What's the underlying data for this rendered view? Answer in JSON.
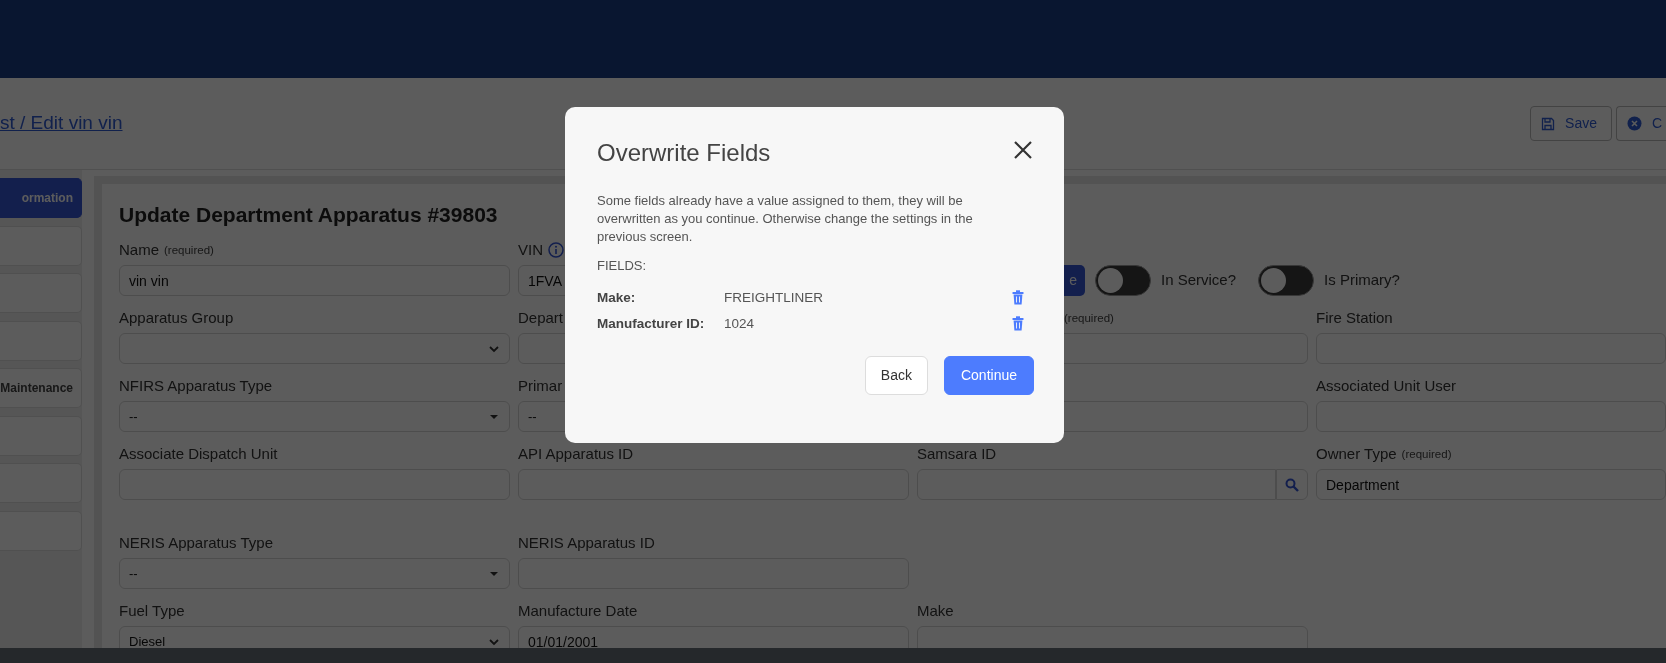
{
  "breadcrumb": {
    "text": "st / Edit vin vin"
  },
  "header_buttons": [
    {
      "kind": "save",
      "label": "Save"
    },
    {
      "kind": "cancel",
      "label": "C"
    }
  ],
  "sidebar": {
    "items": [
      {
        "label": "ormation",
        "selected": true
      },
      {
        "selected": false
      },
      {
        "selected": false
      },
      {
        "selected": false
      },
      {
        "label": "Maintenance",
        "selected": false
      },
      {
        "selected": false
      },
      {
        "selected": false
      },
      {
        "selected": false
      }
    ]
  },
  "form": {
    "title": "Update Department Apparatus #39803",
    "rows": [
      [
        {
          "kind": "input",
          "label": "Name",
          "note": "(required)",
          "value": "vin vin"
        },
        {
          "kind": "input",
          "label": "VIN",
          "info": true,
          "value": "1FVA"
        },
        {
          "kind": "toggles",
          "button": "e",
          "toggles": [
            {
              "label": "In Service?",
              "on": false
            },
            {
              "label": "Is Primary?",
              "on": false
            }
          ]
        }
      ],
      [
        {
          "kind": "select",
          "label": "Apparatus Group"
        },
        {
          "kind": "input",
          "label": "Depart"
        },
        {
          "kind": "input",
          "note": "(required)"
        },
        {
          "kind": "input",
          "label": "Fire Station"
        }
      ],
      [
        {
          "kind": "dropdown",
          "label": "NFIRS Apparatus Type",
          "value": "--"
        },
        {
          "kind": "dropdown",
          "label": "Primar",
          "value": "--"
        },
        {
          "kind": "input"
        },
        {
          "kind": "input",
          "label": "Associated Unit User"
        }
      ],
      [
        {
          "kind": "input",
          "label": "Associate Dispatch Unit"
        },
        {
          "kind": "input",
          "label": "API Apparatus ID"
        },
        {
          "kind": "search",
          "label": "Samsara ID"
        },
        {
          "kind": "input",
          "label": "Owner Type",
          "note": "(required)",
          "value": "Department"
        }
      ],
      [
        {
          "kind": "dropdown",
          "label": "NERIS Apparatus Type",
          "value": "--"
        },
        {
          "kind": "input",
          "label": "NERIS Apparatus ID"
        }
      ],
      [
        {
          "kind": "select",
          "label": "Fuel Type",
          "value": "Diesel"
        },
        {
          "kind": "input",
          "label": "Manufacture Date",
          "value": "01/01/2001"
        },
        {
          "kind": "input",
          "label": "Make"
        }
      ]
    ]
  },
  "modal": {
    "title": "Overwrite Fields",
    "message": "Some fields already have a value assigned to them, they will be overwritten as you continue. Otherwise change the settings in the previous screen.",
    "fields_heading": "FIELDS:",
    "fields": [
      {
        "label": "Make:",
        "value": "FREIGHTLINER"
      },
      {
        "label": "Manufacturer ID:",
        "value": "1024"
      }
    ],
    "buttons": [
      {
        "kind": "secondary",
        "label": "Back"
      },
      {
        "kind": "primary",
        "label": "Continue"
      }
    ]
  }
}
